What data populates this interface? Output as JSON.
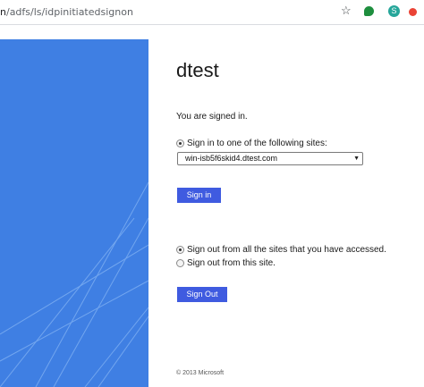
{
  "browser": {
    "url_prefix": "n",
    "url_path": "/adfs/ls/idpinitiatedsignon",
    "avatar_letter": "S",
    "icons": [
      "star-icon",
      "extension-green-icon",
      "profile-avatar",
      "extension-red-icon"
    ]
  },
  "page": {
    "title": "dtest",
    "status_text": "You are signed in.",
    "option_signin_sites": "Sign in to one of the following sites:",
    "site_select_value": "win-isb5f6skid4.dtest.com",
    "signin_button": "Sign in",
    "option_signout_all": "Sign out from all the sites that you have accessed.",
    "option_signout_this": "Sign out from this site.",
    "signout_button": "Sign Out",
    "footer": "© 2013 Microsoft"
  },
  "colors": {
    "graphic_bg": "#3f7fe3",
    "button_bg": "#3f5be0"
  }
}
